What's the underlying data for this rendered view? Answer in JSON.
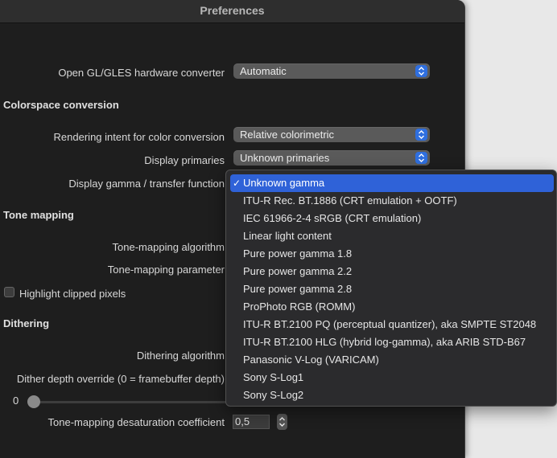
{
  "window": {
    "title": "Preferences"
  },
  "settings": {
    "opengl_label": "Open GL/GLES hardware converter",
    "opengl_value": "Automatic",
    "colorspace_section": "Colorspace conversion",
    "rendering_intent_label": "Rendering intent for color conversion",
    "rendering_intent_value": "Relative colorimetric",
    "display_primaries_label": "Display primaries",
    "display_primaries_value": "Unknown primaries",
    "display_gamma_label": "Display gamma / transfer function",
    "tone_mapping_section": "Tone mapping",
    "tone_mapping_algorithm_label": "Tone-mapping algorithm",
    "tone_mapping_parameter_label": "Tone-mapping parameter",
    "highlight_clipped_label": "Highlight clipped pixels",
    "highlight_clipped_checked": false,
    "dithering_section": "Dithering",
    "dithering_algorithm_label": "Dithering algorithm",
    "dither_depth_label": "Dither depth override (0 = framebuffer depth)",
    "dither_depth_value": "0",
    "desaturation_label": "Tone-mapping desaturation coefficient",
    "desaturation_value": "0,5"
  },
  "gamma_menu": {
    "selected_index": 0,
    "items": [
      "Unknown gamma",
      "ITU-R Rec. BT.1886 (CRT emulation + OOTF)",
      "IEC 61966-2-4 sRGB (CRT emulation)",
      "Linear light content",
      "Pure power gamma 1.8",
      "Pure power gamma 2.2",
      "Pure power gamma 2.8",
      "ProPhoto RGB (ROMM)",
      "ITU-R BT.2100 PQ (perceptual quantizer), aka SMPTE ST2048",
      "ITU-R BT.2100 HLG (hybrid log-gamma), aka ARIB STD-B67",
      "Panasonic V-Log (VARICAM)",
      "Sony S-Log1",
      "Sony S-Log2"
    ]
  },
  "colors": {
    "accent": "#2f62d8",
    "window_bg": "#1e1e1e",
    "popup_bg": "#2b2b2d"
  }
}
